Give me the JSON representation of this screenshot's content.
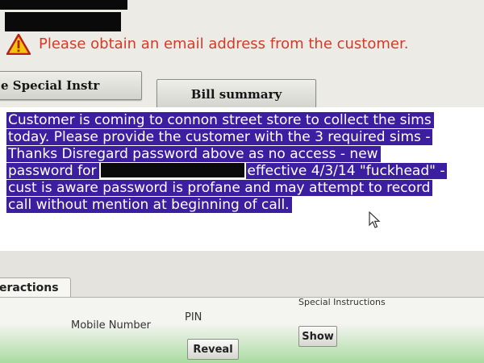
{
  "alert": {
    "icon": "warning-icon",
    "text": "Please obtain an email address from the customer.",
    "color": "#d53a26"
  },
  "tabs": {
    "special_label": "e Special Instr",
    "bill_label": "Bill summary"
  },
  "instructions": {
    "lines": [
      "Customer is coming to connon street store to collect the sims",
      "today. Please provide the customer with the 3 required sims -",
      "Thanks Disregard password above as no access - new",
      "password for",
      "effective 4/3/14 \"fuckhead\" -",
      "cust is aware password is profane and may attempt to record",
      "call without mention at beginning of call."
    ],
    "highlight_color": "#3c1fa0"
  },
  "lower": {
    "tab_label": "eractions",
    "columns": {
      "mobile": "Mobile Number",
      "pin": "PIN",
      "special": "Special Instructions"
    },
    "reveal_label": "Reveal",
    "show_label": "Show"
  }
}
